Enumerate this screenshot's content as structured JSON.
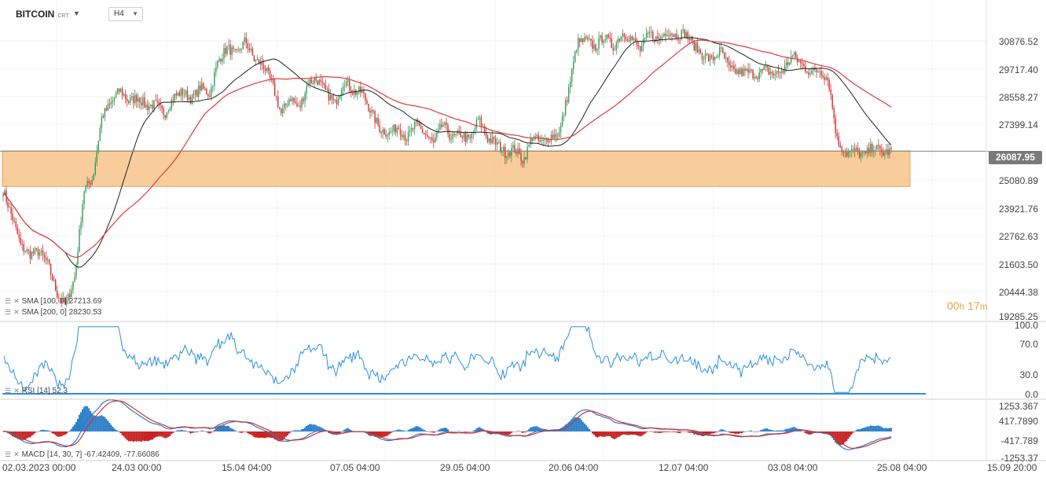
{
  "header": {
    "symbol": "BITCOIN",
    "symbol_suffix": "CRT",
    "timeframe": "H4"
  },
  "price_axis": [
    "30876.52",
    "29717.40",
    "28558.27",
    "27399.14",
    "25080.89",
    "23921.76",
    "22762.63",
    "21603.50",
    "20444.38",
    "19285.25"
  ],
  "current_price": "26087.95",
  "countdown": {
    "hours": "00",
    "h": "h",
    "minutes": "17",
    "m": "m"
  },
  "indicators": {
    "sma100": {
      "label": "SMA [100, 0] 27213.69",
      "color": "#222222"
    },
    "sma200": {
      "label": "SMA [200, 0] 28230.53",
      "color": "#e03a3a"
    },
    "rsi": {
      "label": "RSI [14] 52.3",
      "axis": [
        "100.0",
        "70.0",
        "30.0",
        "0.0"
      ],
      "color": "#2b8fe0"
    },
    "macd": {
      "label": "MACD [14, 30, 7] -67.42409, -77.66086",
      "axis": [
        "1253.367",
        "417.7890",
        "-417.789",
        "-1253.37"
      ]
    }
  },
  "time_axis": [
    "02.03.2023 00:00",
    "24.03 00:00",
    "15.04 04:00",
    "07.05 04:00",
    "29.05 04:00",
    "20.06 04:00",
    "12.07 04:00",
    "03.08 04:00",
    "25.08 04:00",
    "15.09 20:00"
  ],
  "support_zone": {
    "color": "#f7c48a",
    "border": "#e8a060",
    "from": 24650,
    "to": 26100
  },
  "colors": {
    "bull": "#3a9a5a",
    "bear": "#d23232",
    "accent": "#e8a33a"
  },
  "chart_data": {
    "type": "candlestick",
    "ylim": [
      19285.25,
      31500
    ],
    "close_series": [
      24500,
      23400,
      22200,
      21900,
      22000,
      21500,
      20300,
      19800,
      21000,
      24500,
      25000,
      27500,
      28000,
      28600,
      28100,
      28300,
      27900,
      28000,
      27600,
      28300,
      28500,
      28200,
      28700,
      28400,
      29800,
      30300,
      30000,
      30600,
      29800,
      29600,
      28800,
      27600,
      28300,
      27800,
      28900,
      29000,
      28500,
      28000,
      29000,
      28500,
      28500,
      27700,
      27000,
      26800,
      27100,
      26600,
      27200,
      26800,
      26400,
      27200,
      26600,
      26800,
      26500,
      27400,
      26600,
      26400,
      26000,
      26200,
      25700,
      26700,
      26400,
      26700,
      26800,
      28500,
      30500,
      30600,
      30300,
      30800,
      30300,
      30900,
      30700,
      30200,
      30900,
      30600,
      31000,
      30800,
      30900,
      30400,
      30000,
      29800,
      30200,
      29400,
      29300,
      29300,
      29200,
      29400,
      29200,
      29400,
      30000,
      29600,
      29300,
      29400,
      29000,
      26500,
      26000,
      26100,
      25900,
      26300,
      26000,
      26100
    ]
  }
}
